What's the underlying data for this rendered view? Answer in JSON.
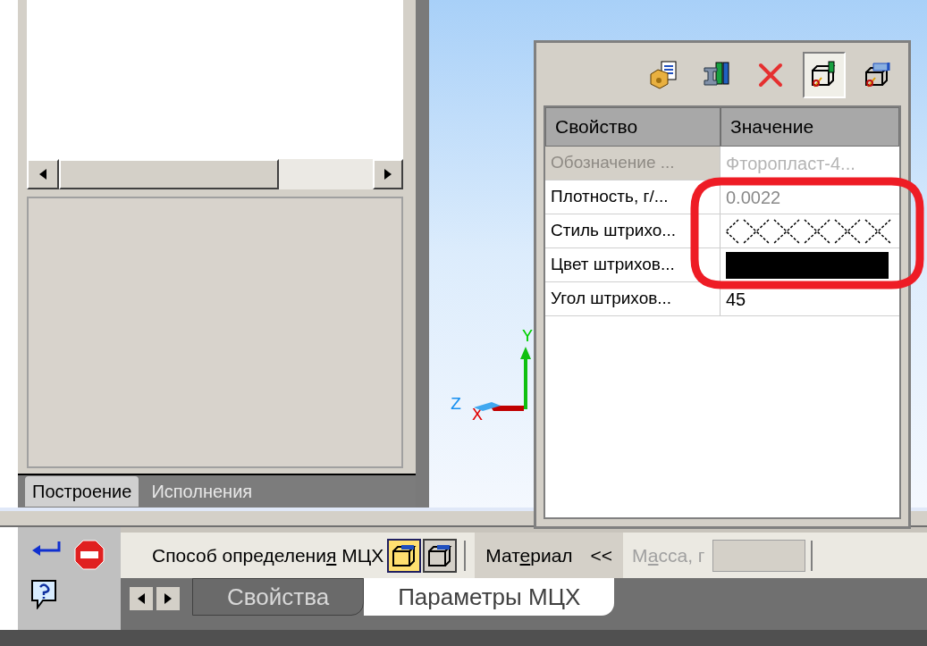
{
  "left_panel": {
    "tabs": [
      {
        "label": "Построение",
        "selected": true
      },
      {
        "label": "Исполнения",
        "selected": false
      }
    ]
  },
  "viewport": {
    "axes": {
      "y": "Y",
      "z": "Z",
      "x": "X"
    }
  },
  "properties_panel": {
    "toolbar": [
      {
        "kind": "box-doc",
        "pressed": false
      },
      {
        "kind": "beam-book",
        "pressed": false
      },
      {
        "kind": "delete",
        "pressed": false
      },
      {
        "kind": "part-book",
        "pressed": true
      },
      {
        "kind": "part-hatch",
        "pressed": false
      }
    ],
    "columns": [
      "Свойство",
      "Значение"
    ],
    "rows": [
      {
        "property": "Обозначение ...",
        "kind": "text",
        "value": "Фторопласт-4...",
        "disabled": true,
        "readonly": false
      },
      {
        "property": "Плотность, г/...",
        "kind": "text",
        "value": "0.0022",
        "disabled": false,
        "readonly": true
      },
      {
        "property": "Стиль штрихо...",
        "kind": "hatch",
        "disabled": false
      },
      {
        "property": "Цвет штрихов...",
        "kind": "swatch",
        "color": "#000000",
        "disabled": false
      },
      {
        "property": "Угол штрихов...",
        "kind": "text",
        "value": "45",
        "disabled": false,
        "readonly": false
      }
    ]
  },
  "toolbar": {
    "method_label": [
      "Способ определени",
      "я",
      " МЦХ"
    ],
    "toggles": [
      {
        "selected": true
      },
      {
        "selected": false
      }
    ],
    "material_button": {
      "label": [
        "Мат",
        "е",
        "риал"
      ],
      "arrows": "<<"
    },
    "mass": {
      "label": [
        "М",
        "а",
        "сса, г"
      ],
      "disabled": true
    }
  },
  "bottom_tabs": [
    {
      "label": "Свойства",
      "selected": false
    },
    {
      "label": "Параметры МЦХ",
      "selected": true
    }
  ]
}
